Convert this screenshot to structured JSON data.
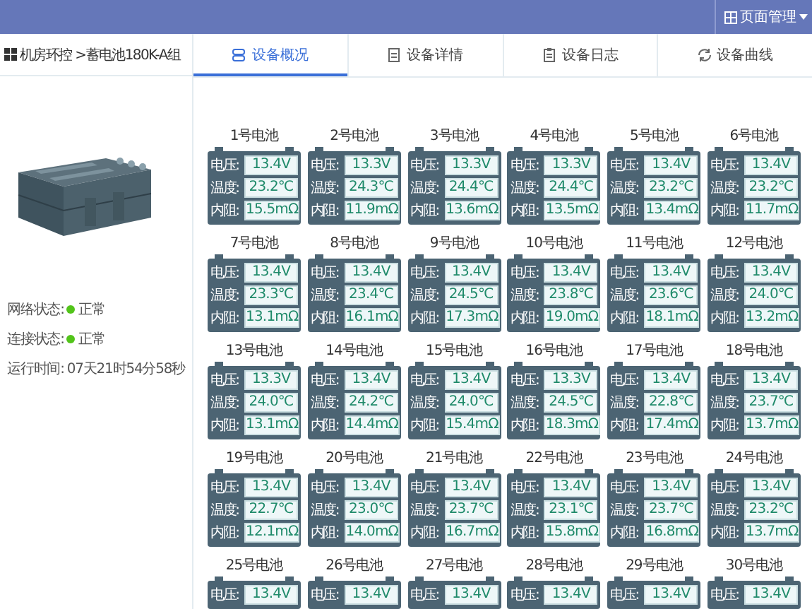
{
  "header": {
    "menu_label": "页面管理"
  },
  "breadcrumb": "机房环控 >蓄电池180K-A组",
  "tabs": [
    {
      "label": "设备概况",
      "selected": true,
      "kind": "overview"
    },
    {
      "label": "设备详情",
      "selected": false,
      "kind": "detail"
    },
    {
      "label": "设备日志",
      "selected": false,
      "kind": "log"
    },
    {
      "label": "设备曲线",
      "selected": false,
      "kind": "curve"
    }
  ],
  "status": [
    {
      "label": "网络状态:",
      "value": "正常",
      "color": "#52c41a"
    },
    {
      "label": "连接状态:",
      "value": "正常",
      "color": "#52c41a"
    },
    {
      "label": "运行时间:",
      "value": "07天21时54分58秒"
    }
  ],
  "batteries": [
    {
      "name": "1号电池",
      "readings": [
        {
          "label": "电压:",
          "value": "13.4V"
        },
        {
          "label": "温度:",
          "value": "23.2℃"
        },
        {
          "label": "内阻:",
          "value": "15.5mΩ"
        }
      ]
    },
    {
      "name": "2号电池",
      "readings": [
        {
          "label": "电压:",
          "value": "13.3V"
        },
        {
          "label": "温度:",
          "value": "24.3℃"
        },
        {
          "label": "内阻:",
          "value": "11.9mΩ"
        }
      ]
    },
    {
      "name": "3号电池",
      "readings": [
        {
          "label": "电压:",
          "value": "13.3V"
        },
        {
          "label": "温度:",
          "value": "24.4℃"
        },
        {
          "label": "内阻:",
          "value": "13.6mΩ"
        }
      ]
    },
    {
      "name": "4号电池",
      "readings": [
        {
          "label": "电压:",
          "value": "13.3V"
        },
        {
          "label": "温度:",
          "value": "24.4℃"
        },
        {
          "label": "内阻:",
          "value": "13.5mΩ"
        }
      ]
    },
    {
      "name": "5号电池",
      "readings": [
        {
          "label": "电压:",
          "value": "13.4V"
        },
        {
          "label": "温度:",
          "value": "23.2℃"
        },
        {
          "label": "内阻:",
          "value": "13.4mΩ"
        }
      ]
    },
    {
      "name": "6号电池",
      "readings": [
        {
          "label": "电压:",
          "value": "13.4V"
        },
        {
          "label": "温度:",
          "value": "23.2℃"
        },
        {
          "label": "内阻:",
          "value": "11.7mΩ"
        }
      ]
    },
    {
      "name": "7号电池",
      "readings": [
        {
          "label": "电压:",
          "value": "13.4V"
        },
        {
          "label": "温度:",
          "value": "23.3℃"
        },
        {
          "label": "内阻:",
          "value": "13.1mΩ"
        }
      ]
    },
    {
      "name": "8号电池",
      "readings": [
        {
          "label": "电压:",
          "value": "13.4V"
        },
        {
          "label": "温度:",
          "value": "23.4℃"
        },
        {
          "label": "内阻:",
          "value": "16.1mΩ"
        }
      ]
    },
    {
      "name": "9号电池",
      "readings": [
        {
          "label": "电压:",
          "value": "13.4V"
        },
        {
          "label": "温度:",
          "value": "24.5℃"
        },
        {
          "label": "内阻:",
          "value": "17.3mΩ"
        }
      ]
    },
    {
      "name": "10号电池",
      "readings": [
        {
          "label": "电压:",
          "value": "13.4V"
        },
        {
          "label": "温度:",
          "value": "23.8℃"
        },
        {
          "label": "内阻:",
          "value": "19.0mΩ"
        }
      ]
    },
    {
      "name": "11号电池",
      "readings": [
        {
          "label": "电压:",
          "value": "13.4V"
        },
        {
          "label": "温度:",
          "value": "23.6℃"
        },
        {
          "label": "内阻:",
          "value": "18.1mΩ"
        }
      ]
    },
    {
      "name": "12号电池",
      "readings": [
        {
          "label": "电压:",
          "value": "13.4V"
        },
        {
          "label": "温度:",
          "value": "24.0℃"
        },
        {
          "label": "内阻:",
          "value": "13.2mΩ"
        }
      ]
    },
    {
      "name": "13号电池",
      "readings": [
        {
          "label": "电压:",
          "value": "13.3V"
        },
        {
          "label": "温度:",
          "value": "24.0℃"
        },
        {
          "label": "内阻:",
          "value": "13.1mΩ"
        }
      ]
    },
    {
      "name": "14号电池",
      "readings": [
        {
          "label": "电压:",
          "value": "13.4V"
        },
        {
          "label": "温度:",
          "value": "24.2℃"
        },
        {
          "label": "内阻:",
          "value": "14.4mΩ"
        }
      ]
    },
    {
      "name": "15号电池",
      "readings": [
        {
          "label": "电压:",
          "value": "13.4V"
        },
        {
          "label": "温度:",
          "value": "24.0℃"
        },
        {
          "label": "内阻:",
          "value": "15.4mΩ"
        }
      ]
    },
    {
      "name": "16号电池",
      "readings": [
        {
          "label": "电压:",
          "value": "13.3V"
        },
        {
          "label": "温度:",
          "value": "24.5℃"
        },
        {
          "label": "内阻:",
          "value": "18.3mΩ"
        }
      ]
    },
    {
      "name": "17号电池",
      "readings": [
        {
          "label": "电压:",
          "value": "13.4V"
        },
        {
          "label": "温度:",
          "value": "22.8℃"
        },
        {
          "label": "内阻:",
          "value": "17.4mΩ"
        }
      ]
    },
    {
      "name": "18号电池",
      "readings": [
        {
          "label": "电压:",
          "value": "13.4V"
        },
        {
          "label": "温度:",
          "value": "23.7℃"
        },
        {
          "label": "内阻:",
          "value": "13.7mΩ"
        }
      ]
    },
    {
      "name": "19号电池",
      "readings": [
        {
          "label": "电压:",
          "value": "13.4V"
        },
        {
          "label": "温度:",
          "value": "22.7℃"
        },
        {
          "label": "内阻:",
          "value": "12.1mΩ"
        }
      ]
    },
    {
      "name": "20号电池",
      "readings": [
        {
          "label": "电压:",
          "value": "13.4V"
        },
        {
          "label": "温度:",
          "value": "23.0℃"
        },
        {
          "label": "内阻:",
          "value": "14.0mΩ"
        }
      ]
    },
    {
      "name": "21号电池",
      "readings": [
        {
          "label": "电压:",
          "value": "13.4V"
        },
        {
          "label": "温度:",
          "value": "23.7℃"
        },
        {
          "label": "内阻:",
          "value": "16.7mΩ"
        }
      ]
    },
    {
      "name": "22号电池",
      "readings": [
        {
          "label": "电压:",
          "value": "13.4V"
        },
        {
          "label": "温度:",
          "value": "23.1℃"
        },
        {
          "label": "内阻:",
          "value": "15.8mΩ"
        }
      ]
    },
    {
      "name": "23号电池",
      "readings": [
        {
          "label": "电压:",
          "value": "13.4V"
        },
        {
          "label": "温度:",
          "value": "23.7℃"
        },
        {
          "label": "内阻:",
          "value": "16.8mΩ"
        }
      ]
    },
    {
      "name": "24号电池",
      "readings": [
        {
          "label": "电压:",
          "value": "13.4V"
        },
        {
          "label": "温度:",
          "value": "23.2℃"
        },
        {
          "label": "内阻:",
          "value": "13.7mΩ"
        }
      ]
    },
    {
      "name": "25号电池",
      "readings": [
        {
          "label": "电压:",
          "value": "13.4V"
        }
      ]
    },
    {
      "name": "26号电池",
      "readings": [
        {
          "label": "电压:",
          "value": "13.4V"
        }
      ]
    },
    {
      "name": "27号电池",
      "readings": [
        {
          "label": "电压:",
          "value": "13.4V"
        }
      ]
    },
    {
      "name": "28号电池",
      "readings": [
        {
          "label": "电压:",
          "value": "13.4V"
        }
      ]
    },
    {
      "name": "29号电池",
      "readings": [
        {
          "label": "电压:",
          "value": "13.4V"
        }
      ]
    },
    {
      "name": "30号电池",
      "readings": [
        {
          "label": "电压:",
          "value": "13.4V"
        }
      ]
    }
  ]
}
